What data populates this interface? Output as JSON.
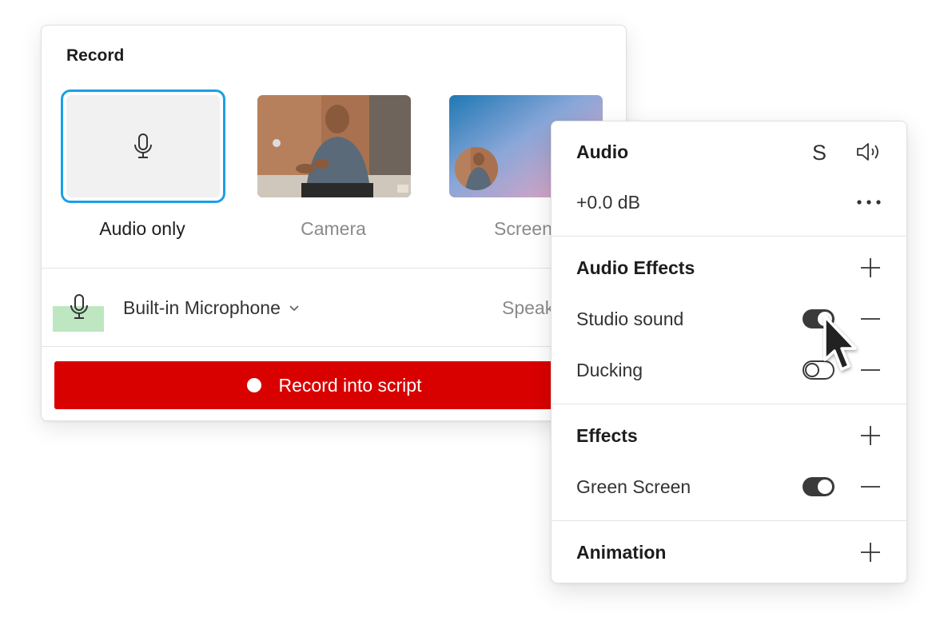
{
  "record_panel": {
    "title": "Record",
    "sources": [
      {
        "label": "Audio only",
        "selected": true,
        "icon": "microphone-icon"
      },
      {
        "label": "Camera",
        "selected": false
      },
      {
        "label": "Screen",
        "selected": false
      }
    ],
    "microphone": {
      "name": "Built-in Microphone",
      "icon": "microphone-icon",
      "dropdown_icon": "chevron-down-icon"
    },
    "speaker_label": "Speak",
    "record_button_label": "Record into script"
  },
  "audio_panel": {
    "audio": {
      "title": "Audio",
      "solo_label": "S",
      "volume_icon": "speaker-icon",
      "gain": "+0.0 dB",
      "more_icon": "more-icon"
    },
    "audio_effects": {
      "title": "Audio Effects",
      "items": [
        {
          "label": "Studio sound",
          "enabled": true
        },
        {
          "label": "Ducking",
          "enabled": false
        }
      ]
    },
    "effects": {
      "title": "Effects",
      "items": [
        {
          "label": "Green Screen",
          "enabled": true
        }
      ]
    },
    "animation": {
      "title": "Animation"
    }
  },
  "colors": {
    "accent": "#1aa0e6",
    "record": "#d90000",
    "mic_level": "#bde6c1",
    "toggle": "#3a3a3a"
  }
}
